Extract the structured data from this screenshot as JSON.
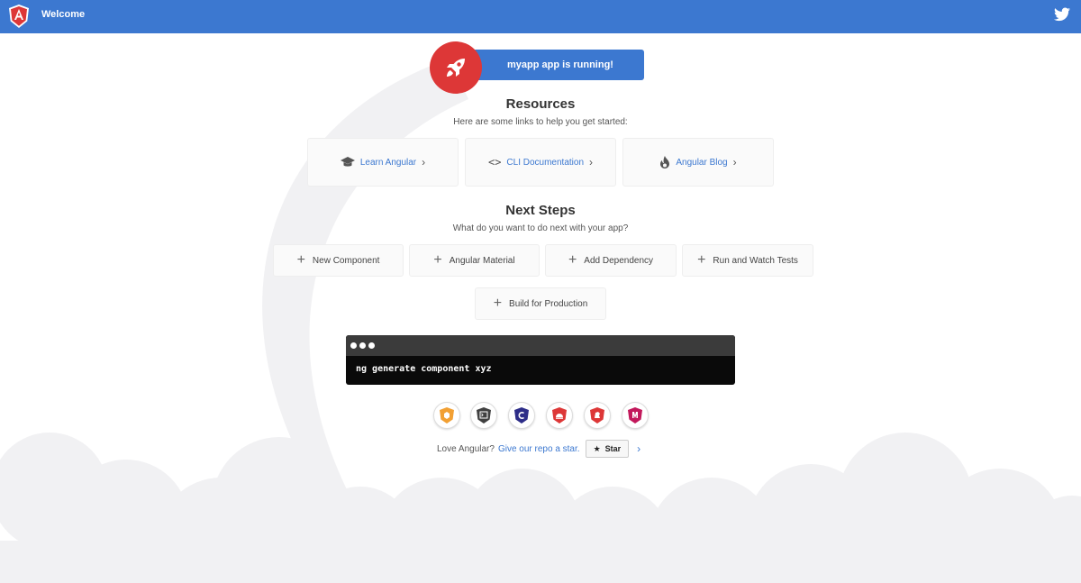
{
  "toolbar": {
    "title": "Welcome",
    "logo_icon": "angular-logo-icon",
    "twitter_icon": "twitter-icon"
  },
  "banner": {
    "running_text": "myapp app is running!",
    "icon": "rocket-icon"
  },
  "resources": {
    "title": "Resources",
    "subtitle": "Here are some links to help you get started:",
    "links": [
      {
        "label": "Learn Angular",
        "icon": "graduation-cap-icon"
      },
      {
        "label": "CLI Documentation",
        "icon": "code-brackets-icon"
      },
      {
        "label": "Angular Blog",
        "icon": "flame-icon"
      }
    ]
  },
  "next_steps": {
    "title": "Next Steps",
    "subtitle": "What do you want to do next with your app?",
    "actions": [
      {
        "label": "New Component"
      },
      {
        "label": "Angular Material"
      },
      {
        "label": "Add Dependency"
      },
      {
        "label": "Run and Watch Tests"
      },
      {
        "label": "Build for Production"
      }
    ]
  },
  "terminal": {
    "command": "ng generate component xyz"
  },
  "ecosystem_icons": [
    {
      "name": "animations-icon",
      "color": "#f2a033"
    },
    {
      "name": "cli-icon",
      "color": "#404040"
    },
    {
      "name": "augury-icon",
      "color": "#2d2d88"
    },
    {
      "name": "protractor-icon",
      "color": "#dd3737"
    },
    {
      "name": "ngrx-icon",
      "color": "#dd3737"
    },
    {
      "name": "angularfire-icon",
      "color": "#c2185b"
    }
  ],
  "footer": {
    "love_text": "Love Angular?",
    "link_text": "Give our repo a star.",
    "star_label": "Star",
    "star_icon": "star-icon",
    "chevron_icon": "chevron-right-icon"
  },
  "colors": {
    "primary": "#3c78d0",
    "accent_red": "#dd3737"
  }
}
